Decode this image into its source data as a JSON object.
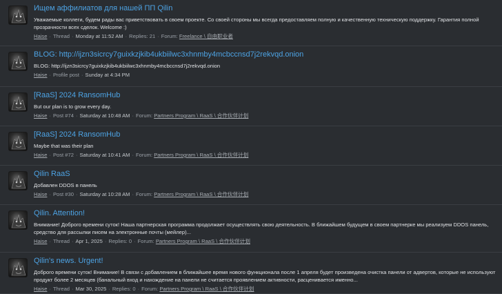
{
  "results": [
    {
      "title": "Ищем аффилиатов для нашей ПП Qilin",
      "snippet": "Уважаемые коллеги, будем рады вас приветствовать в своем проекте. Со своей стороны мы всегда предоставляем полную и качественную техническую поддержку. Гарантия полной прозрачности всех сделок. Welcome :)",
      "author": "Haise",
      "type": "Thread",
      "time": "Monday at 11:52 AM",
      "extra": "Replies: 21",
      "forum_label": "Forum:",
      "forum": "Freelance \\ 自由职业者"
    },
    {
      "title": "BLOG: http://ijzn3sicrcy7guixkzjkib4ukbiilwc3xhnmby4mcbccnsd7j2rekvqd.onion",
      "snippet": "BLOG: http://ijzn3sicrcy7guixkzjkib4ukbiilwc3xhnmby4mcbccnsd7j2rekvqd.onion",
      "author": "Haise",
      "type": "Profile post",
      "time": "Sunday at 4:34 PM",
      "extra": "",
      "forum_label": "",
      "forum": ""
    },
    {
      "title": "[RaaS] 2024 RansomHub",
      "snippet": "But our plan is to grow every day.",
      "author": "Haise",
      "type": "Post #74",
      "time": "Saturday at 10:48 AM",
      "extra": "",
      "forum_label": "Forum:",
      "forum": "Partners Program \\ RaaS \\ 合作伙伴计划"
    },
    {
      "title": "[RaaS] 2024 RansomHub",
      "snippet": "Maybe that was their plan",
      "author": "Haise",
      "type": "Post #72",
      "time": "Saturday at 10:41 AM",
      "extra": "",
      "forum_label": "Forum:",
      "forum": "Partners Program \\ RaaS \\ 合作伙伴计划"
    },
    {
      "title": "Qilin RaaS",
      "snippet": "Добавлен DDOS в панель",
      "author": "Haise",
      "type": "Post #30",
      "time": "Saturday at 10:28 AM",
      "extra": "",
      "forum_label": "Forum:",
      "forum": "Partners Program \\ RaaS \\ 合作伙伴计划"
    },
    {
      "title": "Qilin. Attention!",
      "snippet": "Внимание! Доброго времени суток! Наша партнерская программа продолжает осуществлять свою деятельность. В ближайшем будущем в своем партнерке мы реализуем DDOS панель, средство для рассылки писем на электронные почты (мейлер)...",
      "author": "Haise",
      "type": "Thread",
      "time": "Apr 1, 2025",
      "extra": "Replies: 0",
      "forum_label": "Forum:",
      "forum": "Partners Program \\ RaaS \\ 合作伙伴计划"
    },
    {
      "title": "Qilin's news. Urgent!",
      "snippet": "Доброго времени суток! Внимание! В связи с добавлением в ближайшее время нового функционала после 1 апреля будет произведена очистка панели от адвертов, которые не используют продукт более 2 месяцев (банальный вход и нахождение на панели не считается проявлением активности, расценивается именно...",
      "author": "Haise",
      "type": "Thread",
      "time": "Mar 30, 2025",
      "extra": "Replies: 0",
      "forum_label": "Forum:",
      "forum": "Partners Program \\ RaaS \\ 合作伙伴计划"
    }
  ],
  "separator": "·",
  "colors": {
    "background": "#2a2d31",
    "title_link": "#4da3e4",
    "snippet_text": "#e0e2e5",
    "meta_text": "#9aa0a7"
  },
  "icons": {
    "avatar": "user-avatar-icon"
  }
}
